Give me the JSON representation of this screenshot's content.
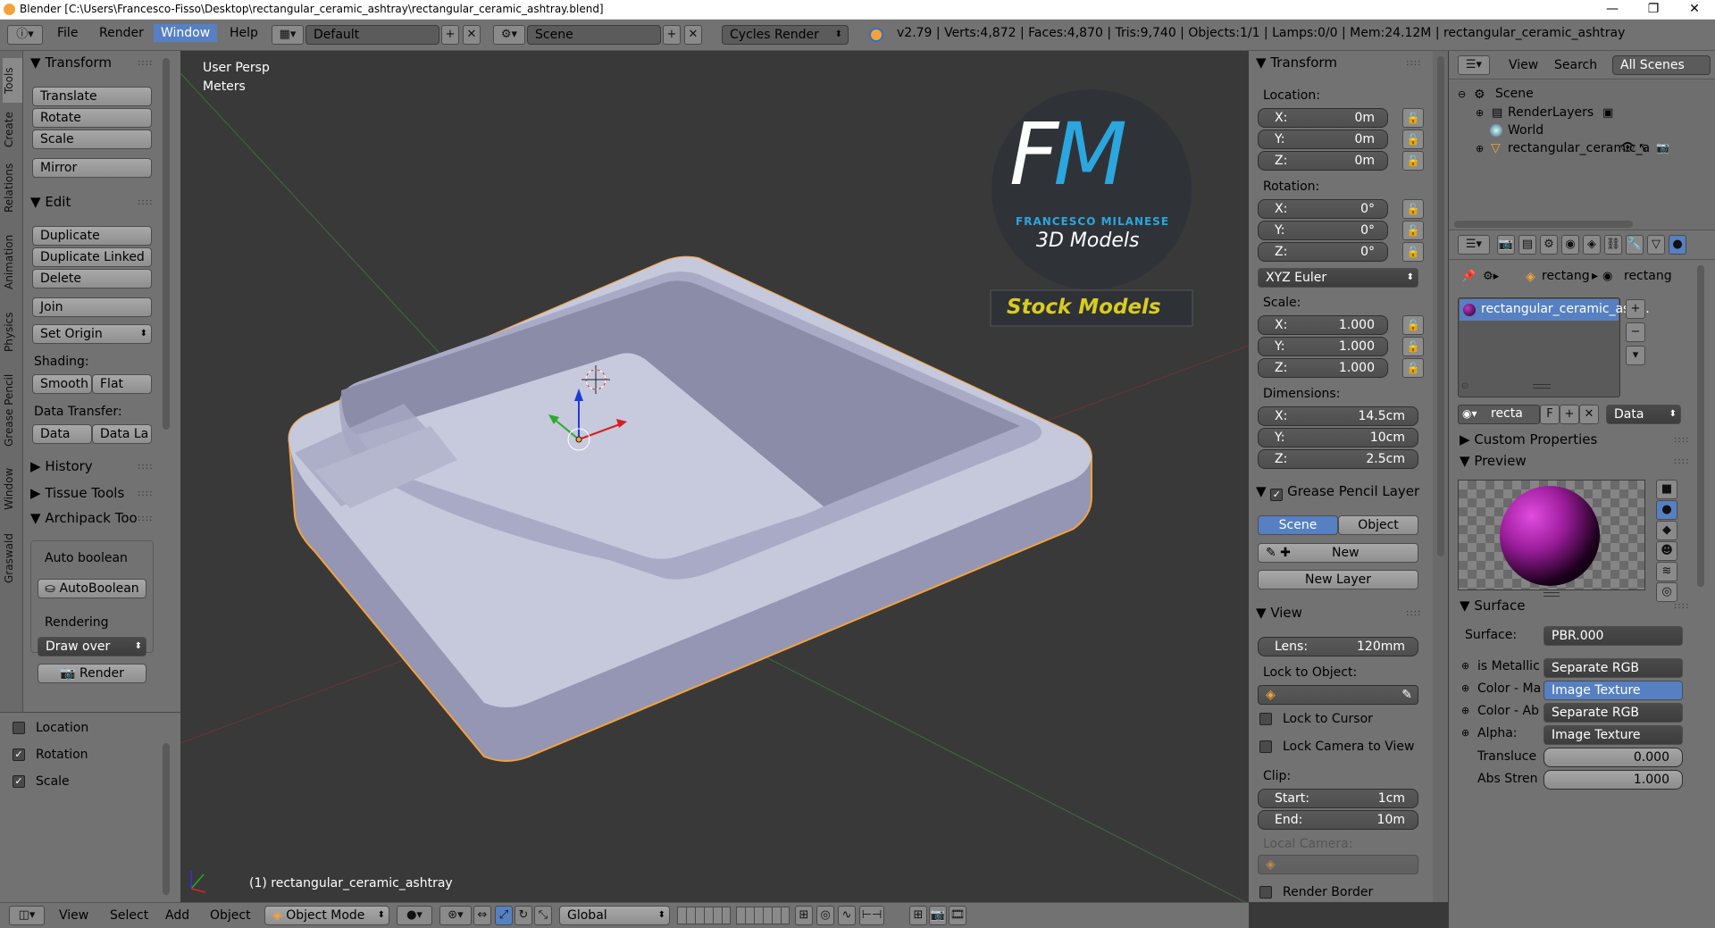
{
  "title_bar": {
    "title": "Blender [C:\\Users\\Francesco-Fisso\\Desktop\\rectangular_ceramic_ashtray\\rectangular_ceramic_ashtray.blend]",
    "minimize": "—",
    "maximize": "❐",
    "close": "✕"
  },
  "top_menu": {
    "items": [
      "File",
      "Render",
      "Window",
      "Help"
    ],
    "layout": "Default",
    "scene": "Scene",
    "engine": "Cycles Render",
    "stats": "v2.79 | Verts:4,872 | Faces:4,870 | Tris:9,740 | Objects:1/1 | Lamps:0/0 | Mem:24.12M | rectangular_ceramic_ashtray"
  },
  "left_tabs": [
    "Tools",
    "Create",
    "Relations",
    "Animation",
    "Physics",
    "Grease Pencil",
    "Window",
    "Graswald"
  ],
  "tool_shelf": {
    "transform_header": "Transform",
    "translate": "Translate",
    "rotate": "Rotate",
    "scale": "Scale",
    "mirror": "Mirror",
    "edit_header": "Edit",
    "duplicate": "Duplicate",
    "duplicate_linked": "Duplicate Linked",
    "delete": "Delete",
    "join": "Join",
    "set_origin": "Set Origin",
    "shading_label": "Shading:",
    "smooth": "Smooth",
    "flat": "Flat",
    "data_transfer_label": "Data Transfer:",
    "data": "Data",
    "data_la": "Data La",
    "history": "History",
    "tissue_tools": "Tissue Tools",
    "archipack": "Archipack Too",
    "auto_boolean_label": "Auto boolean",
    "auto_boolean_btn": "AutoBoolean",
    "rendering_label": "Rendering",
    "draw_over": "Draw over",
    "render_btn": "Render"
  },
  "operator_panel": {
    "location": "Location",
    "rotation": "Rotation",
    "scale": "Scale",
    "location_checked": false,
    "rotation_checked": true,
    "scale_checked": true
  },
  "viewport": {
    "view_name": "User Persp",
    "units": "Meters",
    "object_label": "(1) rectangular_ceramic_ashtray",
    "logo_letters": "FM",
    "logo_name": "FRANCESCO MILANESE",
    "logo_sub": "3D Models",
    "stock_label": "Stock Models"
  },
  "n_panel": {
    "transform_header": "Transform",
    "location_label": "Location:",
    "loc": [
      {
        "axis": "X:",
        "val": "0m"
      },
      {
        "axis": "Y:",
        "val": "0m"
      },
      {
        "axis": "Z:",
        "val": "0m"
      }
    ],
    "rotation_label": "Rotation:",
    "rot": [
      {
        "axis": "X:",
        "val": "0°"
      },
      {
        "axis": "Y:",
        "val": "0°"
      },
      {
        "axis": "Z:",
        "val": "0°"
      }
    ],
    "rotation_mode": "XYZ Euler",
    "scale_label": "Scale:",
    "scale": [
      {
        "axis": "X:",
        "val": "1.000"
      },
      {
        "axis": "Y:",
        "val": "1.000"
      },
      {
        "axis": "Z:",
        "val": "1.000"
      }
    ],
    "dimensions_label": "Dimensions:",
    "dim": [
      {
        "axis": "X:",
        "val": "14.5cm"
      },
      {
        "axis": "Y:",
        "val": "10cm"
      },
      {
        "axis": "Z:",
        "val": "2.5cm"
      }
    ],
    "gp_header": "Grease Pencil Layer",
    "gp_scene": "Scene",
    "gp_object": "Object",
    "gp_new": "New",
    "gp_new_layer": "New Layer",
    "view_header": "View",
    "lens_label": "Lens:",
    "lens_val": "120mm",
    "lock_object_label": "Lock to Object:",
    "lock_cursor": "Lock to Cursor",
    "lock_camera": "Lock Camera to View",
    "clip_label": "Clip:",
    "clip_start_label": "Start:",
    "clip_start": "1cm",
    "clip_end_label": "End:",
    "clip_end": "10m",
    "local_camera": "Local Camera:",
    "render_border": "Render Border"
  },
  "outliner": {
    "view": "View",
    "search": "Search",
    "filter": "All Scenes",
    "items": [
      "Scene",
      "RenderLayers",
      "World",
      "rectangular_ceramic_a"
    ]
  },
  "properties": {
    "crumb1": "rectang",
    "crumb2": "rectang",
    "material_slot": "rectangular_ceramic_ash...",
    "mat_name": "recta",
    "mat_f": "F",
    "mat_data": "Data",
    "custom_props": "Custom Properties",
    "preview": "Preview",
    "surface_header": "Surface",
    "surface_label": "Surface:",
    "surface_val": "PBR.000",
    "rows": [
      {
        "label": "is Metallic",
        "val": "Separate RGB"
      },
      {
        "label": "Color - Ma",
        "val": "Image Texture"
      },
      {
        "label": "Color - Ab",
        "val": "Separate RGB"
      },
      {
        "label": "Alpha:",
        "val": "Image Texture"
      }
    ],
    "translucent_label": "Transluce",
    "translucent_val": "0.000",
    "abs_label": "Abs Stren",
    "abs_val": "1.000"
  },
  "bottom_bar": {
    "view": "View",
    "select": "Select",
    "add": "Add",
    "object": "Object",
    "mode": "Object Mode",
    "orientation": "Global"
  },
  "colors": {
    "bg": "#393939",
    "panel": "#727272",
    "accent": "#5680c2",
    "object_outline": "#f5a23b"
  }
}
